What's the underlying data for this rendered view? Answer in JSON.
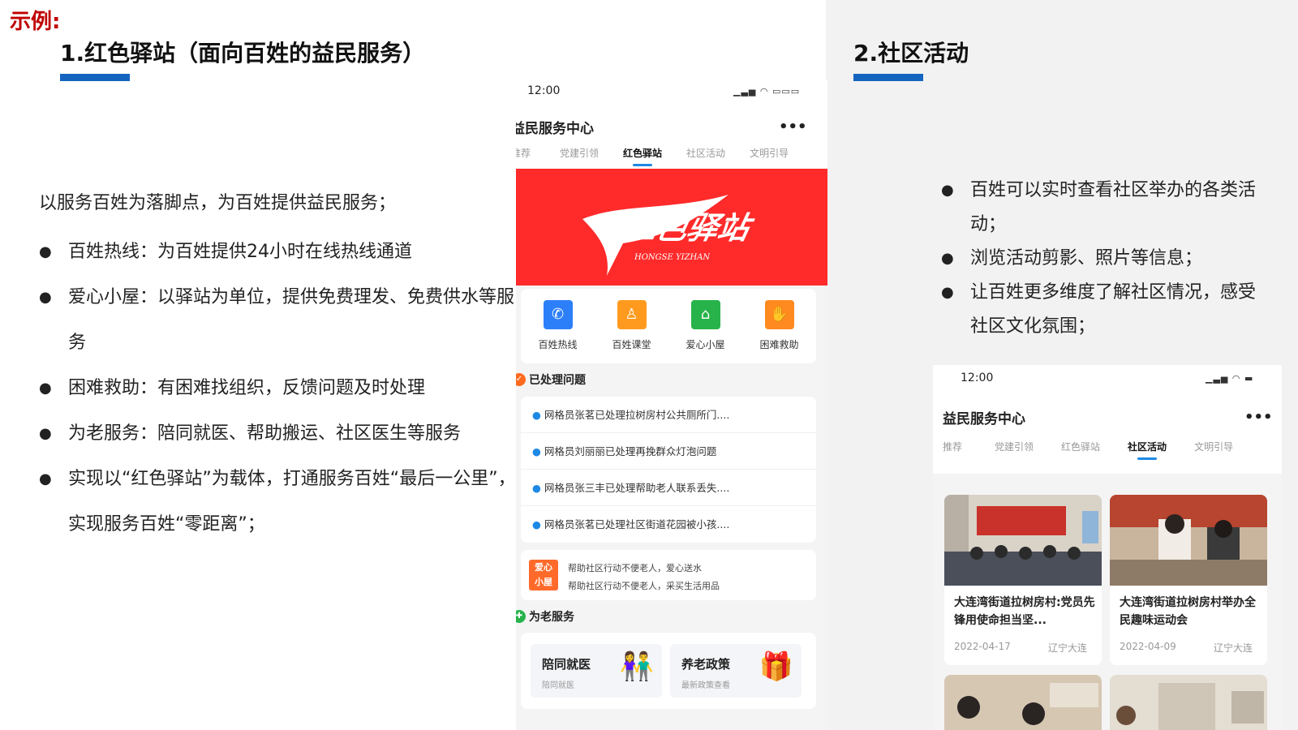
{
  "example_label": "示例:",
  "section1": {
    "title": "1.红色驿站（面向百姓的益民服务）",
    "intro": "以服务百姓为落脚点，为百姓提供益民服务；",
    "bullets": [
      "百姓热线：为百姓提供24小时在线热线通道",
      "爱心小屋：以驿站为单位，提供免费理发、免费供水等服务",
      "困难救助：有困难找组织，反馈问题及时处理",
      "为老服务：陪同就医、帮助搬运、社区医生等服务",
      "实现以“红色驿站”为载体，打通服务百姓“最后一公里”，实现服务百姓“零距离”；"
    ]
  },
  "section2": {
    "title": "2.社区活动",
    "bullets": [
      "百姓可以实时查看社区举办的各类活动；",
      "浏览活动剪影、照片等信息；",
      "让百姓更多维度了解社区情况，感受社区文化氛围；"
    ]
  },
  "phone1": {
    "time": "12:00",
    "app_title": "益民服务中心",
    "more": "•••",
    "tabs": [
      "推荐",
      "党建引领",
      "红色驿站",
      "社区活动",
      "文明引导"
    ],
    "active_tab": "红色驿站",
    "banner_logo": "红色驿站",
    "banner_sub": "HONGSE YIZHAN",
    "services": [
      {
        "label": "百姓热线",
        "icon": "phone-icon",
        "color": "#2d7ff9",
        "glyph": "✆"
      },
      {
        "label": "百姓课堂",
        "icon": "teacher-icon",
        "color": "#ff9a1f",
        "glyph": "♙"
      },
      {
        "label": "爱心小屋",
        "icon": "house-icon",
        "color": "#27b34a",
        "glyph": "⌂"
      },
      {
        "label": "困难救助",
        "icon": "help-icon",
        "color": "#ff8a1f",
        "glyph": "✋"
      }
    ],
    "processed_title": "已处理问题",
    "issues": [
      "网格员张茗已处理拉树房村公共厕所门....",
      "网格员刘丽丽已处理再挽群众灯泡问题",
      "网格员张三丰已处理帮助老人联系丢失....",
      "网格员张茗已处理社区街道花园被小孩...."
    ],
    "love_badge": [
      "爱心",
      "小屋"
    ],
    "love_lines": [
      "帮助社区行动不便老人，爱心送水",
      "帮助社区行动不便老人，采买生活用品"
    ],
    "elder_title": "为老服务",
    "elder_cards": [
      {
        "title": "陪同就医",
        "sub": "陪同就医"
      },
      {
        "title": "养老政策",
        "sub": "最新政策查看"
      }
    ]
  },
  "phone2": {
    "time": "12:00",
    "app_title": "益民服务中心",
    "more": "•••",
    "tabs": [
      "推荐",
      "党建引领",
      "红色驿站",
      "社区活动",
      "文明引导"
    ],
    "active_tab": "社区活动",
    "activities": [
      {
        "title": "大连湾街道拉树房村:党员先锋用使命担当坚...",
        "date": "2022-04-17",
        "location": "辽宁大连"
      },
      {
        "title": "大连湾街道拉树房村举办全民趣味运动会",
        "date": "2022-04-09",
        "location": "辽宁大连"
      }
    ]
  },
  "colors": {
    "accent_blue": "#1565c0",
    "example_red": "#c00000",
    "banner_red": "#ff2a2a"
  }
}
